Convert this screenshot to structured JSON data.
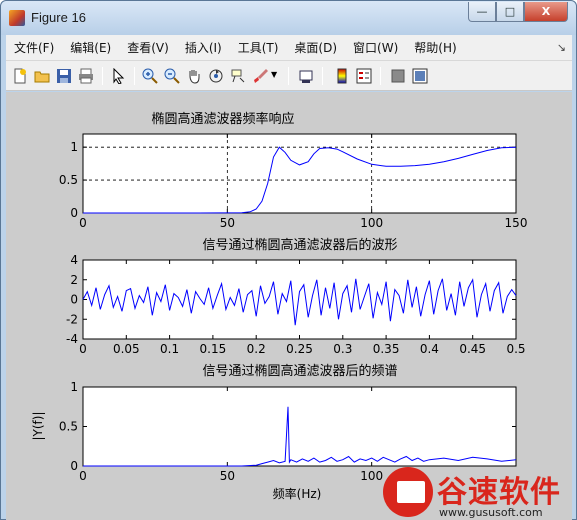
{
  "window": {
    "title": "Figure 16",
    "buttons": {
      "minimize": "—",
      "maximize": "□",
      "close": "X"
    }
  },
  "menubar": {
    "items": [
      {
        "label": "文件(F)"
      },
      {
        "label": "编辑(E)"
      },
      {
        "label": "查看(V)"
      },
      {
        "label": "插入(I)"
      },
      {
        "label": "工具(T)"
      },
      {
        "label": "桌面(D)"
      },
      {
        "label": "窗口(W)"
      },
      {
        "label": "帮助(H)"
      }
    ]
  },
  "toolbar": {
    "icons": [
      "new-figure-icon",
      "open-file-icon",
      "save-icon",
      "print-icon",
      "edit-plot-arrow-icon",
      "zoom-in-icon",
      "zoom-out-icon",
      "pan-hand-icon",
      "rotate-3d-icon",
      "data-cursor-icon",
      "brush-icon",
      "link-plot-icon",
      "insert-colorbar-icon",
      "insert-legend-icon",
      "hide-plot-tools-icon",
      "show-plot-tools-icon"
    ]
  },
  "colors": {
    "line": "#0000ff",
    "figure_bg": "#cccccc",
    "axes_bg": "#ffffff",
    "watermark": "#d9261c"
  },
  "chart_data": [
    {
      "type": "line",
      "title": "椭圆高通滤波器频率响应",
      "xlabel": "",
      "ylabel": "",
      "xlim": [
        0,
        150
      ],
      "ylim": [
        0,
        1.2
      ],
      "xticks": [
        "0",
        "50",
        "100",
        "150"
      ],
      "yticks": [
        "0",
        "0.5",
        "1"
      ],
      "grid": true,
      "series": [
        {
          "x": [
            0,
            20,
            40,
            55,
            58,
            60,
            62,
            64,
            66,
            68,
            70,
            72,
            75,
            78,
            80,
            82,
            85,
            88,
            90,
            95,
            100,
            105,
            110,
            115,
            120,
            125,
            130,
            135,
            140,
            145,
            150
          ],
          "y": [
            0,
            0,
            0,
            0.005,
            0.02,
            0.06,
            0.18,
            0.45,
            0.85,
            1.0,
            0.92,
            0.8,
            0.73,
            0.78,
            0.9,
            0.98,
            0.99,
            0.97,
            0.93,
            0.82,
            0.74,
            0.71,
            0.71,
            0.72,
            0.74,
            0.78,
            0.83,
            0.89,
            0.95,
            0.99,
            1.0
          ]
        }
      ]
    },
    {
      "type": "line",
      "title": "信号通过椭圆高通滤波器后的波形",
      "xlabel": "",
      "ylabel": "",
      "xlim": [
        0,
        0.5
      ],
      "ylim": [
        -4,
        4
      ],
      "xticks": [
        "0",
        "0.05",
        "0.1",
        "0.15",
        "0.2",
        "0.25",
        "0.3",
        "0.35",
        "0.4",
        "0.45",
        "0.5"
      ],
      "yticks": [
        "-4",
        "-2",
        "0",
        "2",
        "4"
      ],
      "grid": false,
      "series": [
        {
          "x": [
            0,
            0.005,
            0.01,
            0.015,
            0.02,
            0.025,
            0.03,
            0.035,
            0.04,
            0.045,
            0.05,
            0.055,
            0.06,
            0.065,
            0.07,
            0.075,
            0.08,
            0.085,
            0.09,
            0.095,
            0.1,
            0.105,
            0.11,
            0.115,
            0.12,
            0.125,
            0.13,
            0.135,
            0.14,
            0.145,
            0.15,
            0.155,
            0.16,
            0.165,
            0.17,
            0.175,
            0.18,
            0.185,
            0.19,
            0.195,
            0.2,
            0.205,
            0.21,
            0.215,
            0.22,
            0.225,
            0.23,
            0.235,
            0.24,
            0.245,
            0.25,
            0.255,
            0.26,
            0.265,
            0.27,
            0.275,
            0.28,
            0.285,
            0.29,
            0.295,
            0.3,
            0.305,
            0.31,
            0.315,
            0.32,
            0.325,
            0.33,
            0.335,
            0.34,
            0.345,
            0.35,
            0.355,
            0.36,
            0.365,
            0.37,
            0.375,
            0.38,
            0.385,
            0.39,
            0.395,
            0.4,
            0.405,
            0.41,
            0.415,
            0.42,
            0.425,
            0.43,
            0.435,
            0.44,
            0.445,
            0.45,
            0.455,
            0.46,
            0.465,
            0.47,
            0.475,
            0.48,
            0.485,
            0.49,
            0.495,
            0.5
          ],
          "y": [
            0,
            0.8,
            -0.6,
            1.2,
            -1.0,
            0.5,
            1.4,
            -0.8,
            0.3,
            -1.2,
            0.9,
            1.1,
            -0.9,
            0.4,
            -0.3,
            1.3,
            -1.6,
            0.7,
            -0.2,
            1.5,
            -1.1,
            0.6,
            0.2,
            -0.7,
            1.0,
            -1.4,
            0.8,
            0.1,
            -0.5,
            1.2,
            -0.9,
            0.4,
            1.6,
            -1.0,
            0.2,
            -0.6,
            1.1,
            -1.3,
            0.5,
            0.9,
            -1.7,
            1.4,
            -0.4,
            0.3,
            1.8,
            -1.5,
            0.6,
            -0.2,
            1.9,
            -2.6,
            0.8,
            1.5,
            -1.8,
            0.4,
            2.0,
            -1.6,
            1.2,
            -0.9,
            1.7,
            -2.0,
            0.6,
            1.4,
            -1.3,
            2.1,
            -1.0,
            0.3,
            1.6,
            -1.9,
            0.7,
            -0.5,
            1.8,
            -2.2,
            1.0,
            0.4,
            -1.4,
            2.0,
            -0.8,
            1.3,
            -1.7,
            0.5,
            1.9,
            -1.5,
            0.9,
            2.1,
            -1.1,
            0.6,
            -1.6,
            1.8,
            -0.7,
            1.2,
            2.0,
            -1.8,
            0.5,
            1.6,
            -1.2,
            0.9,
            1.7,
            -1.4,
            0.3,
            1.0,
            0.4
          ]
        }
      ]
    },
    {
      "type": "line",
      "title": "信号通过椭圆高通滤波器后的频谱",
      "xlabel": "频率(Hz)",
      "ylabel": "|Y(f)|",
      "xlim": [
        0,
        150
      ],
      "ylim": [
        0,
        1
      ],
      "xticks": [
        "0",
        "50",
        "100"
      ],
      "yticks": [
        "0",
        "0.5",
        "1"
      ],
      "grid": false,
      "series": [
        {
          "x": [
            0,
            30,
            55,
            60,
            62,
            64,
            66,
            68,
            70,
            71,
            71.5,
            72,
            74,
            76,
            78,
            80,
            82,
            84,
            86,
            88,
            90,
            92,
            94,
            96,
            98,
            100,
            102,
            104,
            106,
            108,
            110,
            112,
            114,
            116,
            118,
            120,
            125,
            130,
            135,
            140,
            145,
            150
          ],
          "y": [
            0,
            0,
            0,
            0.01,
            0.03,
            0.05,
            0.07,
            0.04,
            0.06,
            0.75,
            0.05,
            0.08,
            0.05,
            0.09,
            0.06,
            0.1,
            0.05,
            0.07,
            0.11,
            0.06,
            0.08,
            0.12,
            0.05,
            0.09,
            0.07,
            0.1,
            0.06,
            0.11,
            0.08,
            0.05,
            0.09,
            0.12,
            0.07,
            0.1,
            0.06,
            0.08,
            0.1,
            0.07,
            0.11,
            0.09,
            0.06,
            0.08
          ]
        }
      ]
    }
  ],
  "watermark": {
    "name": "谷速软件",
    "url": "www.gususoft.com"
  }
}
